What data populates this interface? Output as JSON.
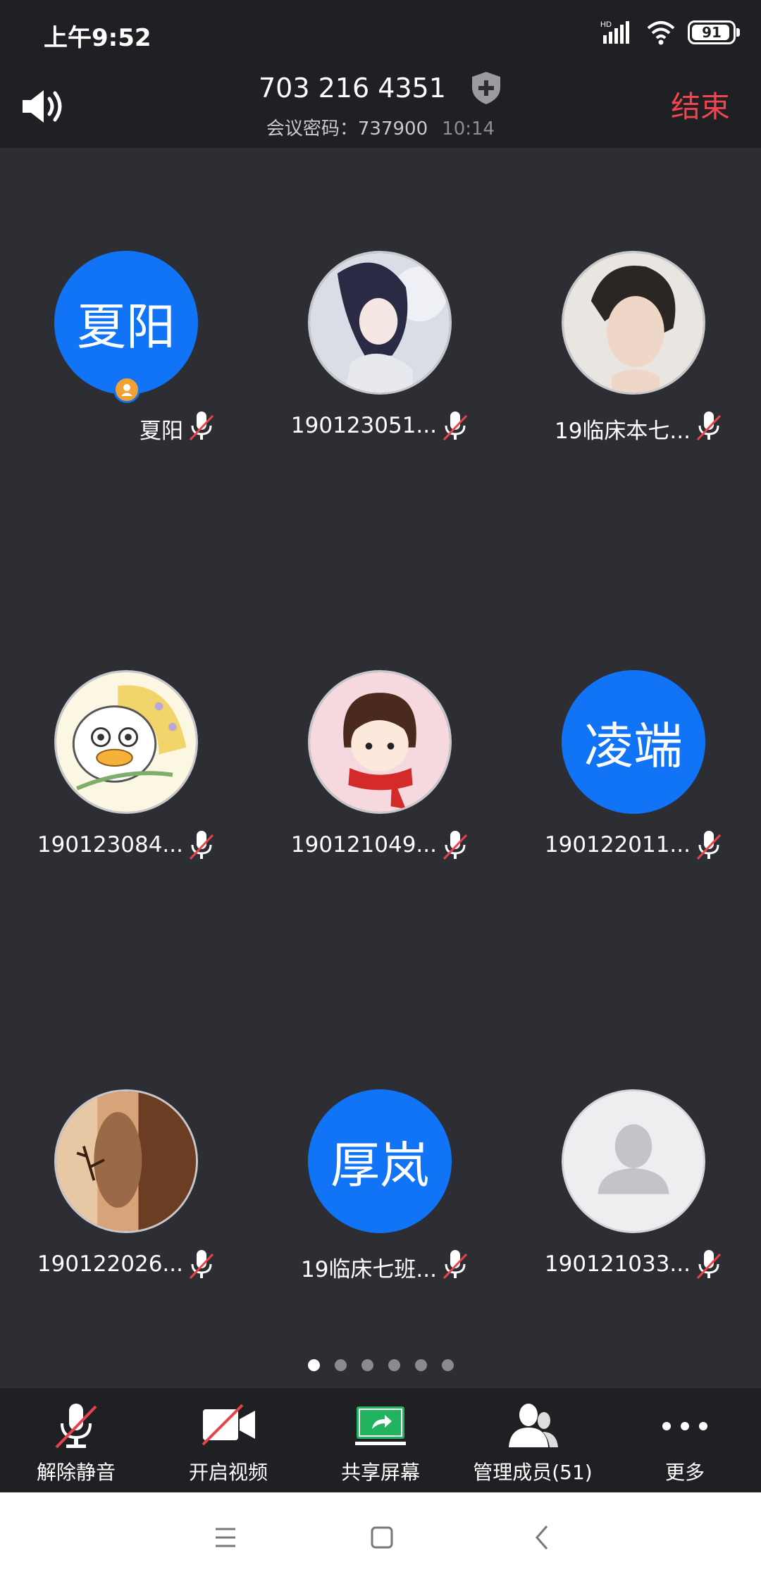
{
  "status_bar": {
    "time": "上午9:52",
    "network": "HD",
    "battery": "91"
  },
  "header": {
    "meeting_id": "703 216 4351",
    "password_label": "会议密码：737900",
    "duration": "10:14",
    "end_label": "结束"
  },
  "participants": [
    {
      "name": "夏阳",
      "avatar_text": "夏阳"
    },
    {
      "name": "190123051..."
    },
    {
      "name": "19临床本七..."
    },
    {
      "name": "190123084..."
    },
    {
      "name": "190121049..."
    },
    {
      "name": "190122011...",
      "avatar_text": "凌端"
    },
    {
      "name": "190122026..."
    },
    {
      "name": "19临床七班...",
      "avatar_text": "厚岚"
    },
    {
      "name": "190121033..."
    }
  ],
  "pager": {
    "pages": 6,
    "current": 1
  },
  "toolbar": {
    "unmute": "解除静音",
    "video": "开启视频",
    "share": "共享屏幕",
    "members": "管理成员(51)",
    "more": "更多"
  },
  "colors": {
    "accent": "#1173f5",
    "end": "#f0444e",
    "share_green": "#22b35e"
  }
}
